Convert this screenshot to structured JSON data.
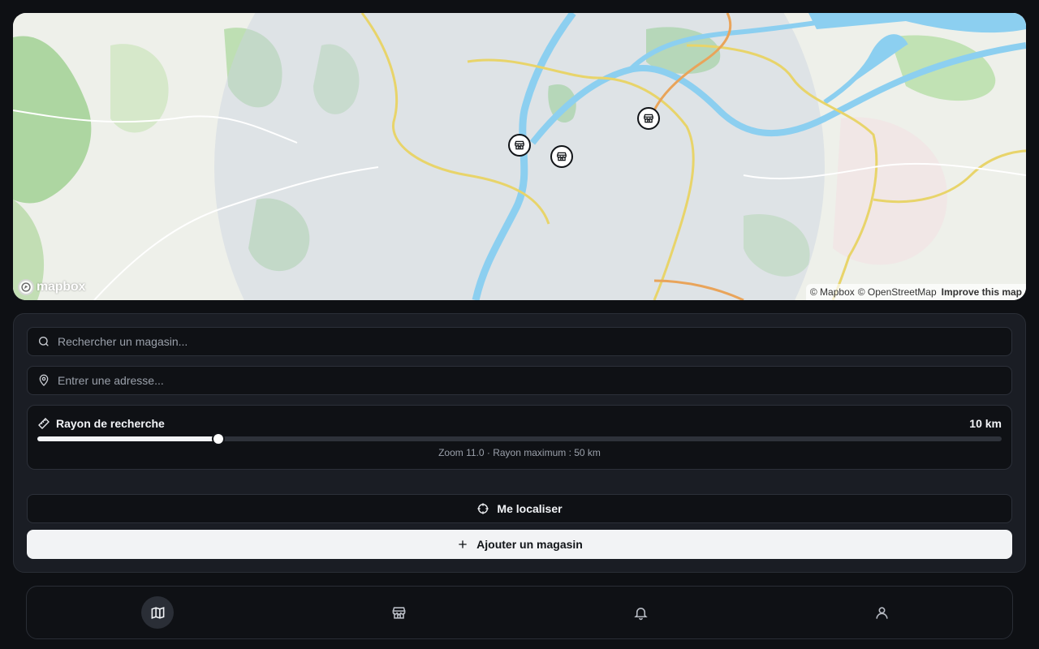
{
  "map": {
    "logo_text": "mapbox",
    "attribution": {
      "mapbox": "© Mapbox",
      "osm": "© OpenStreetMap",
      "improve": "Improve this map"
    },
    "markers": [
      "store-icon",
      "store-icon",
      "store-icon"
    ]
  },
  "search": {
    "placeholder": "Rechercher un magasin..."
  },
  "address": {
    "placeholder": "Entrer une adresse..."
  },
  "radius": {
    "label": "Rayon de recherche",
    "value_label": "10 km",
    "value_km": 10,
    "max_km": 50,
    "fill_fraction": 0.188,
    "hint": "Zoom 11.0 · Rayon maximum : 50 km"
  },
  "actions": {
    "locate_label": "Me localiser",
    "add_label": "Ajouter un magasin"
  },
  "nav": {
    "items": [
      {
        "icon": "map-icon",
        "active": true
      },
      {
        "icon": "store-icon",
        "active": false
      },
      {
        "icon": "bell-icon",
        "active": false
      },
      {
        "icon": "user-icon",
        "active": false
      }
    ]
  },
  "colors": {
    "background": "#0e1014",
    "panel": "#1a1d24",
    "accent_light": "#f2f3f5",
    "water": "#8ccff0",
    "park": "#9fd6a0"
  }
}
